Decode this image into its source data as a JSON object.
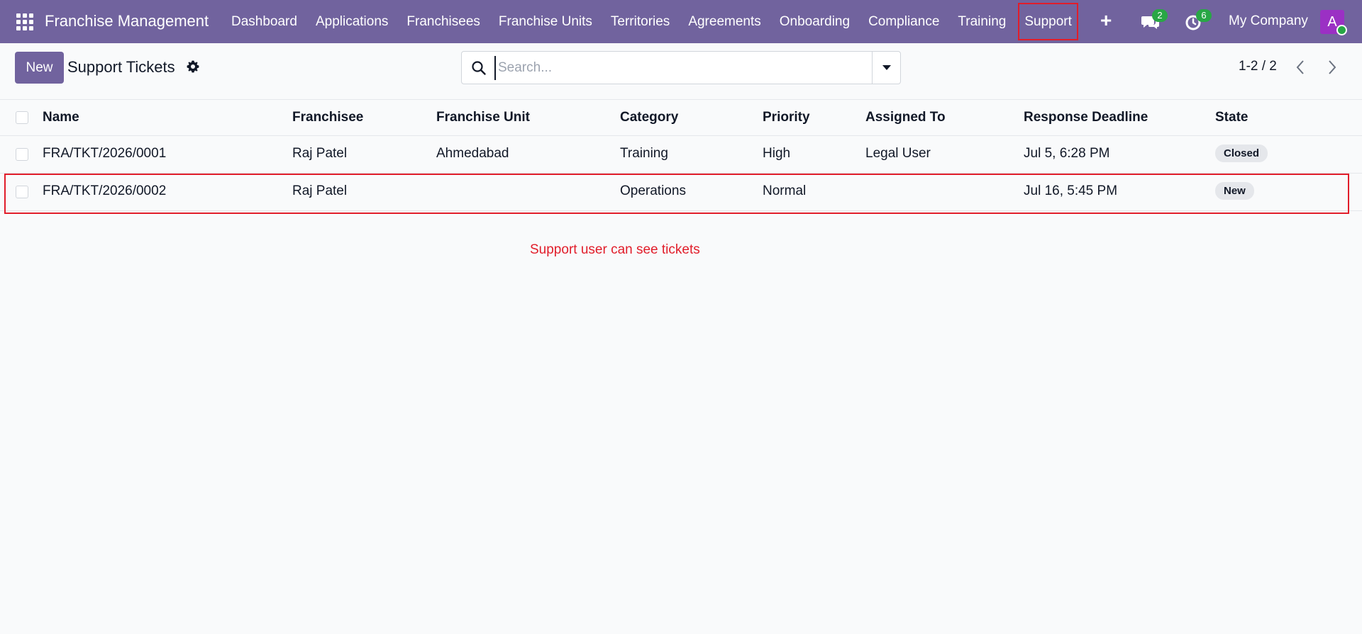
{
  "navbar": {
    "brand": "Franchise Management",
    "menu": [
      {
        "label": "Dashboard"
      },
      {
        "label": "Applications"
      },
      {
        "label": "Franchisees"
      },
      {
        "label": "Franchise Units"
      },
      {
        "label": "Territories"
      },
      {
        "label": "Agreements"
      },
      {
        "label": "Onboarding"
      },
      {
        "label": "Compliance"
      },
      {
        "label": "Training"
      },
      {
        "label": "Support"
      }
    ],
    "active_menu": "Support",
    "plus_icon": "plus-icon",
    "messages_count": "2",
    "activities_count": "6",
    "company": "My Company",
    "avatar_letter": "A",
    "brand_color": "#71639e"
  },
  "control_panel": {
    "new_label": "New",
    "title": "Support Tickets",
    "search_placeholder": "Search...",
    "pager": "1-2 / 2"
  },
  "table": {
    "columns": [
      "Name",
      "Franchisee",
      "Franchise Unit",
      "Category",
      "Priority",
      "Assigned To",
      "Response Deadline",
      "State"
    ],
    "rows": [
      {
        "name": "FRA/TKT/2026/0001",
        "franchisee": "Raj Patel",
        "unit": "Ahmedabad",
        "category": "Training",
        "priority": "High",
        "assigned": "Legal User",
        "deadline": "Jul 5, 6:28 PM",
        "state": "Closed"
      },
      {
        "name": "FRA/TKT/2026/0002",
        "franchisee": "Raj Patel",
        "unit": "",
        "category": "Operations",
        "priority": "Normal",
        "assigned": "",
        "deadline": "Jul 16, 5:45 PM",
        "state": "New"
      }
    ]
  },
  "annotation": {
    "text": "Support user can see tickets",
    "color": "#e11d2a"
  }
}
